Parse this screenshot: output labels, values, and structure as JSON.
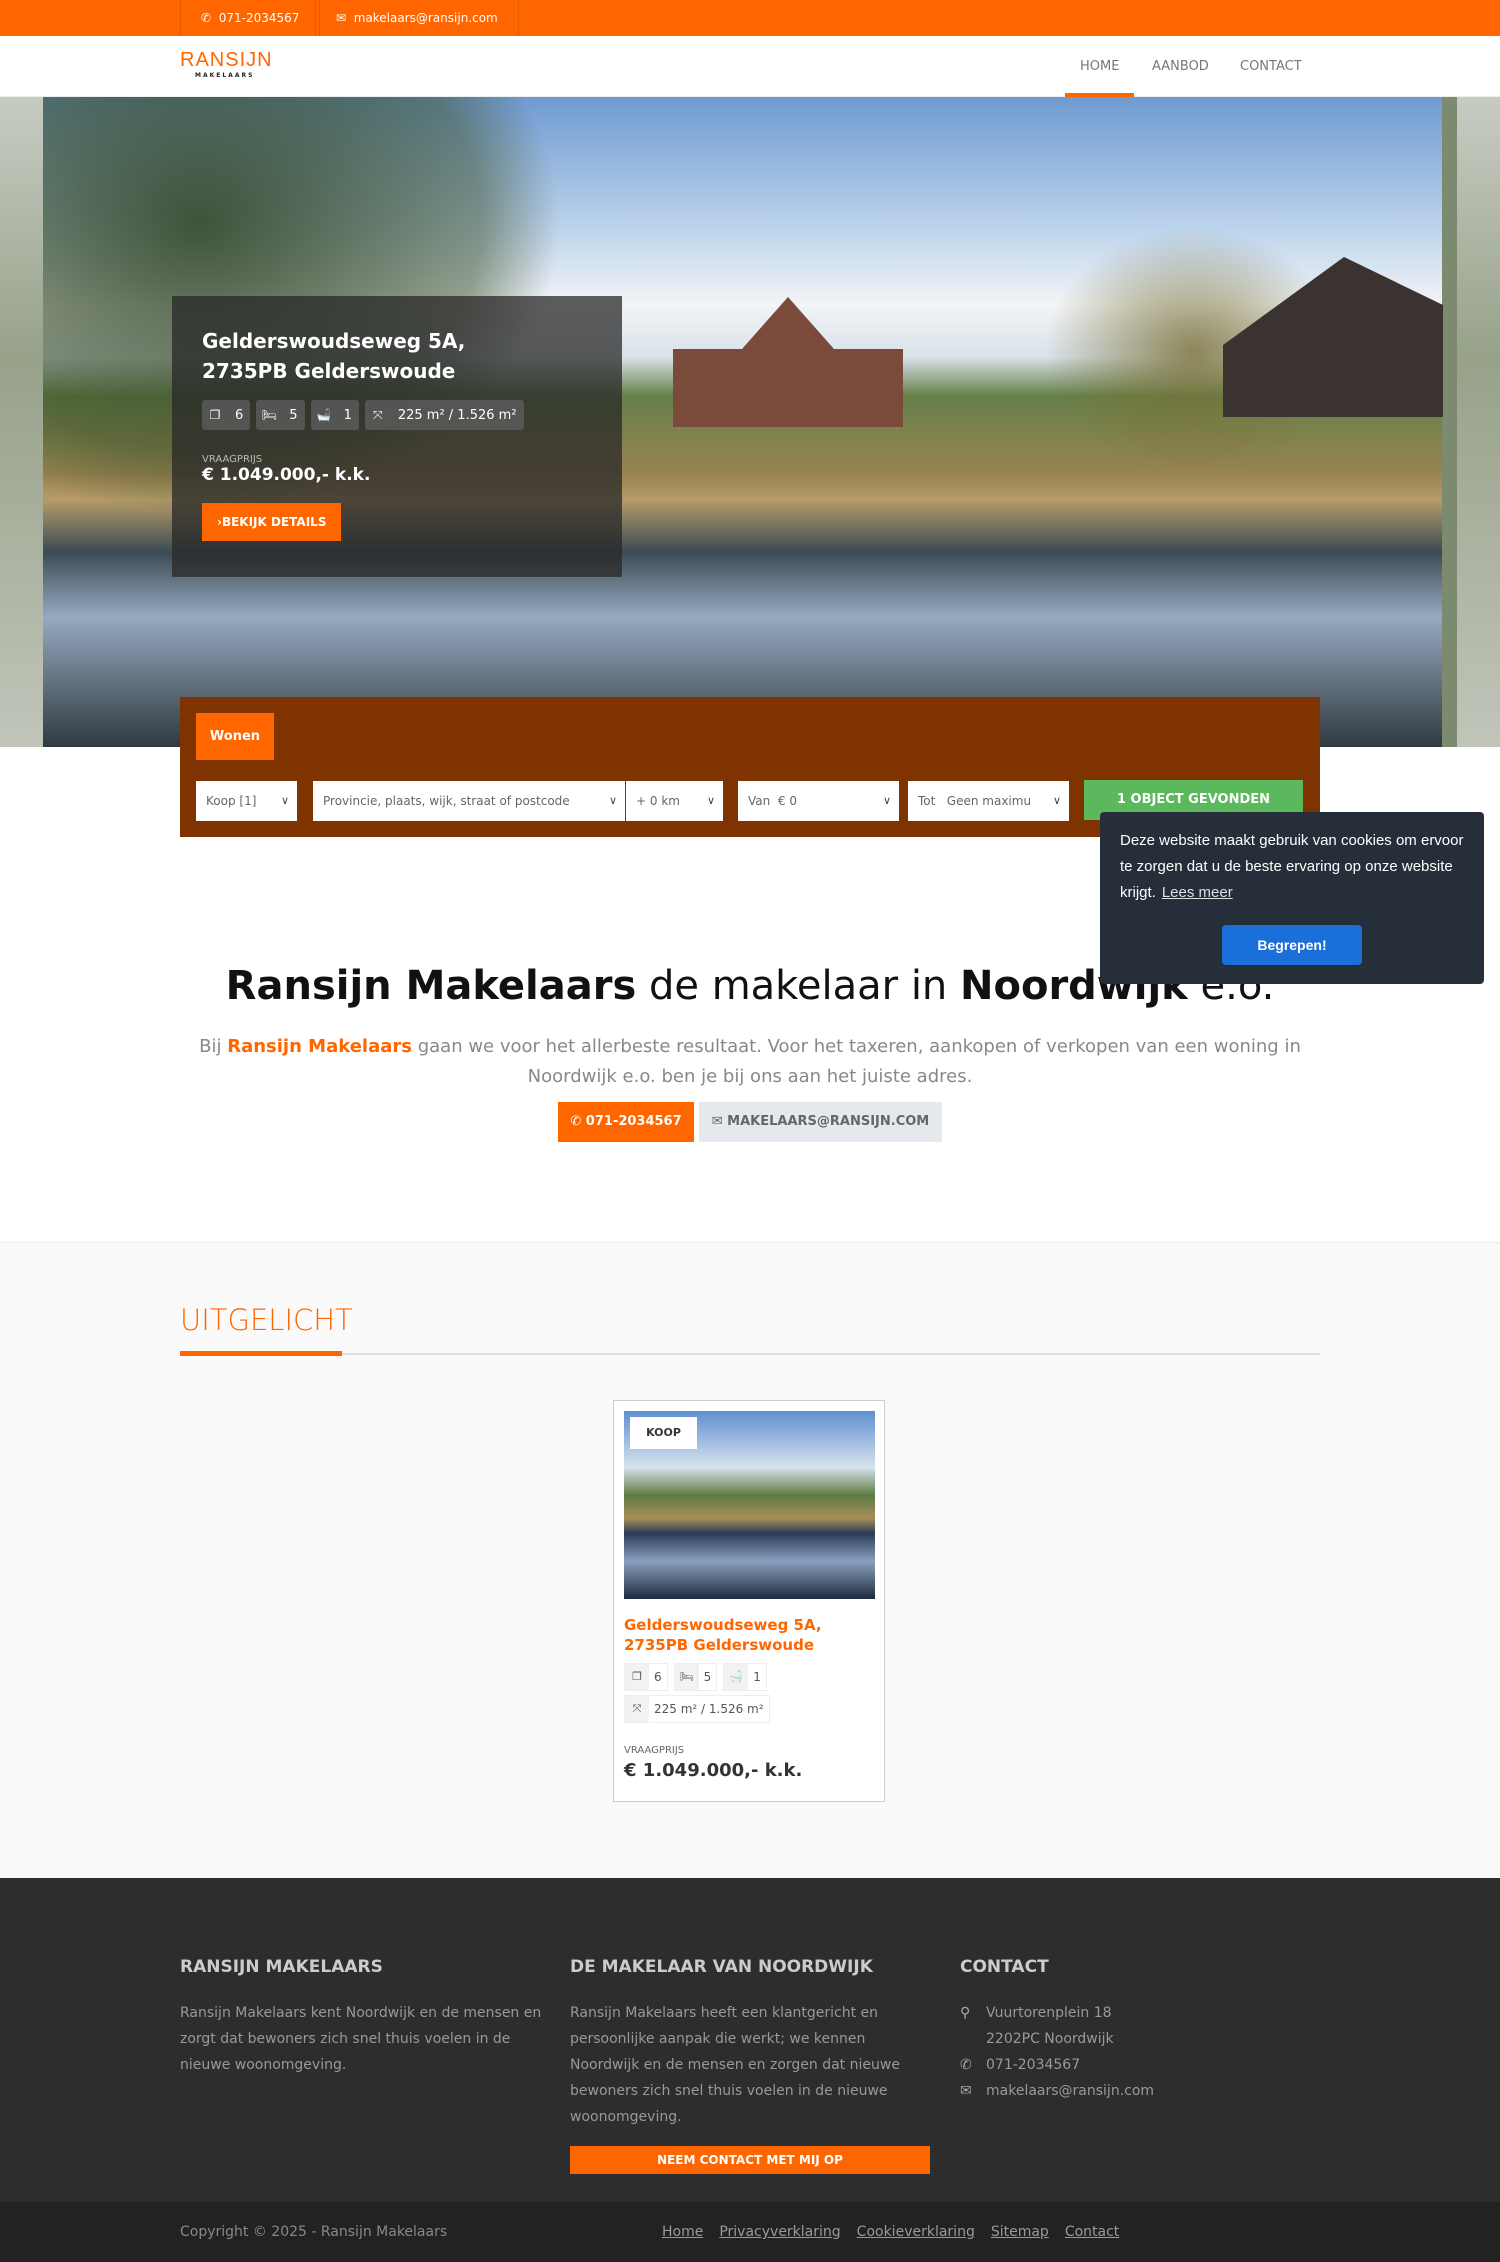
{
  "topbar": {
    "phone": "071-2034567",
    "email": "makelaars@ransijn.com"
  },
  "header": {
    "logo_main": "RANSIJN",
    "logo_sub": "MAKELAARS",
    "nav": [
      {
        "label": "HOME",
        "active": true
      },
      {
        "label": "AANBOD"
      },
      {
        "label": "CONTACT"
      }
    ]
  },
  "hero": {
    "title": "Gelderswoudseweg 5A, 2735PB Gelderswoude",
    "rooms": "6",
    "bedrooms": "5",
    "bathrooms": "1",
    "area": "225 m² / 1.526 m²",
    "price_label": "VRAAGPRIJS",
    "price": "€ 1.049.000,- k.k.",
    "details_button": "BEKIJK DETAILS"
  },
  "search": {
    "tab": "Wonen",
    "type": "Koop [1]",
    "location_placeholder": "Provincie, plaats, wijk, straat of postcode",
    "radius": "+ 0 km",
    "from_label": "Van",
    "from_value": "€ 0",
    "to_label": "Tot",
    "to_value": "Geen maximu",
    "found_button": "1 OBJECT GEVONDEN"
  },
  "cookie": {
    "text": "Deze website maakt gebruik van cookies om ervoor te zorgen dat u de beste ervaring op onze website krijgt.",
    "link": "Lees meer",
    "button": "Begrepen!"
  },
  "intro": {
    "title_bold1": "Ransijn Makelaars",
    "title_mid": " de makelaar in ",
    "title_bold2": "Noordwijk",
    "title_end": " e.o.",
    "p_start": "Bij ",
    "p_brand": "Ransijn Makelaars",
    "p_rest": " gaan we voor het allerbeste resultaat. Voor het taxeren, aankopen of verkopen van een woning in Noordwijk e.o. ben je bij ons aan het juiste adres.",
    "phone_button": "071-2034567",
    "email_button": "MAKELAARS@RANSIJN.COM"
  },
  "featured": {
    "heading": "UITGELICHT",
    "card": {
      "badge": "KOOP",
      "title": "Gelderswoudseweg 5A, 2735PB Gelderswoude",
      "rooms": "6",
      "bedrooms": "5",
      "bathrooms": "1",
      "area": "225 m² / 1.526 m²",
      "price_label": "VRAAGPRIJS",
      "price": "€ 1.049.000,- k.k."
    }
  },
  "footer": {
    "col1": {
      "title": "RANSIJN MAKELAARS",
      "text": "Ransijn Makelaars kent Noordwijk en de mensen en zorgt dat bewoners zich snel thuis voelen in de nieuwe woonomgeving."
    },
    "col2": {
      "title": "DE MAKELAAR VAN NOORDWIJK",
      "text": "Ransijn Makelaars heeft een klantgericht en persoonlijke aanpak die werkt; we kennen Noordwijk en de mensen en zorgen dat nieuwe bewoners zich snel thuis voelen in de nieuwe woonomgeving.",
      "button": "NEEM CONTACT MET MIJ OP"
    },
    "col3": {
      "title": "CONTACT",
      "street": "Vuurtorenplein 18",
      "city": "2202PC Noordwijk",
      "phone": "071-2034567",
      "email": "makelaars@ransijn.com"
    }
  },
  "bottom": {
    "copyright": "Copyright © 2025 - Ransijn Makelaars",
    "links": [
      "Home",
      "Privacyverklaring",
      "Cookieverklaring",
      "Sitemap",
      "Contact"
    ]
  },
  "colors": {
    "brand": "#ff6600",
    "search_bg": "#7f3300",
    "found": "#5cb85c",
    "cookie_bg": "#252e39",
    "cookie_btn": "#1a6fd8",
    "footer": "#2d2d2d"
  }
}
